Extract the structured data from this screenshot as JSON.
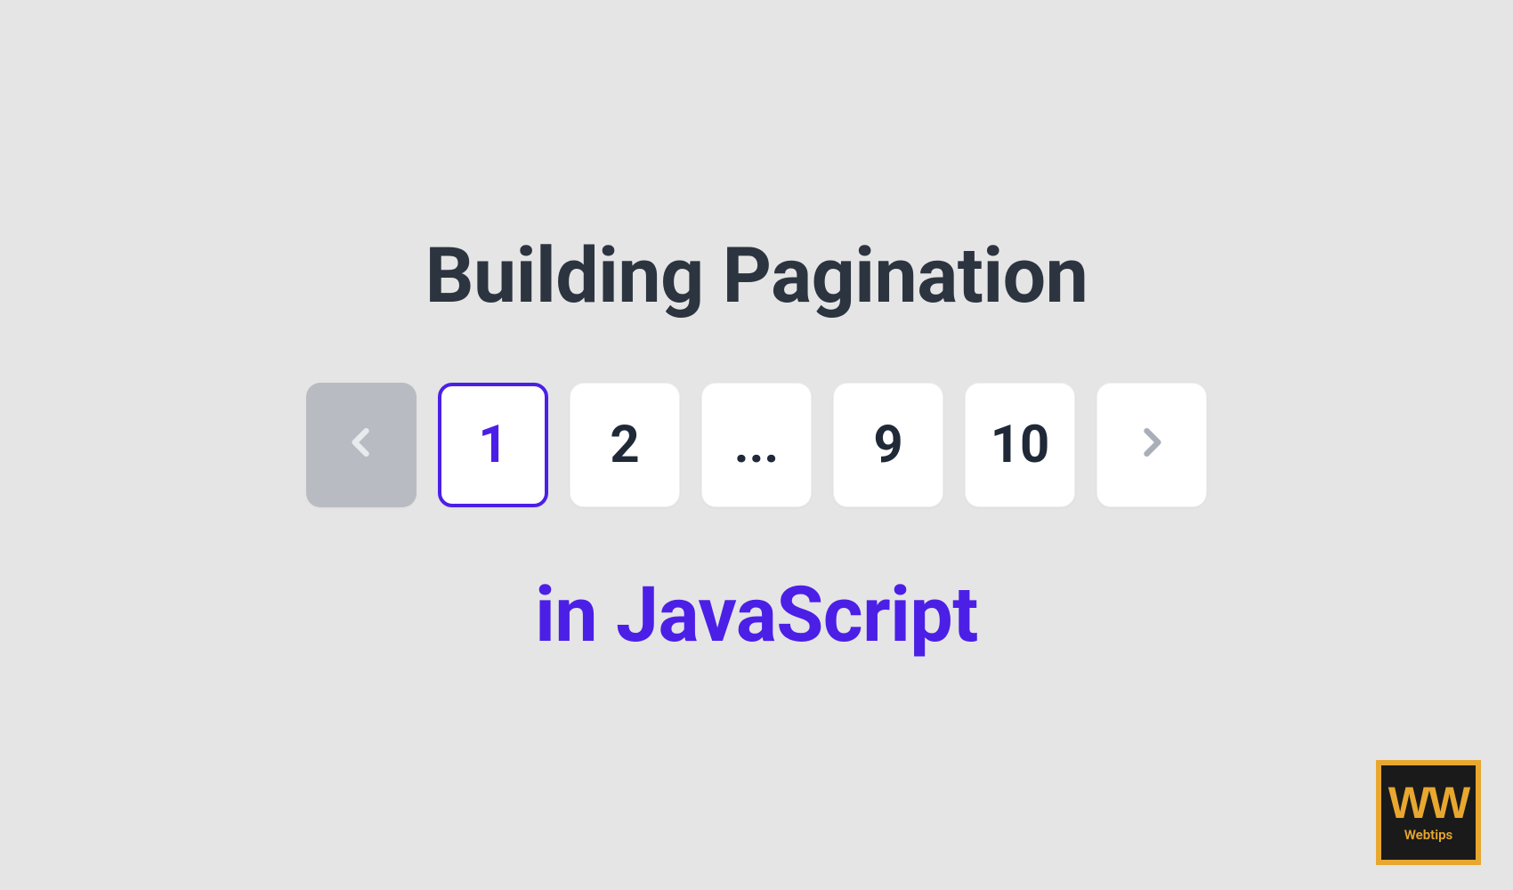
{
  "title": "Building Pagination",
  "subtitle": "in JavaScript",
  "pagination": {
    "prev_disabled": true,
    "pages": [
      {
        "label": "1",
        "active": true
      },
      {
        "label": "2",
        "active": false
      },
      {
        "label": "...",
        "active": false,
        "ellipsis": true
      },
      {
        "label": "9",
        "active": false
      },
      {
        "label": "10",
        "active": false
      }
    ],
    "next_disabled": false
  },
  "logo": {
    "mark": "WW",
    "label": "Webtips"
  }
}
